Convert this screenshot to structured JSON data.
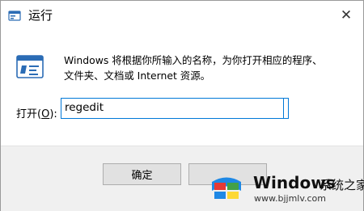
{
  "window": {
    "title": "运行",
    "close_glyph": "✕"
  },
  "content": {
    "description_line1": "Windows 将根据你所输入的名称，为你打开相应的程序、",
    "description_line2": "文件夹、文档或 Internet 资源。",
    "open_label_prefix": "打开(",
    "open_label_key": "O",
    "open_label_suffix": "):",
    "input_value": "regedit"
  },
  "buttons": {
    "ok_label": "确定",
    "cancel_label": ""
  },
  "watermark": {
    "title": "Windows",
    "subtitle": "系统之家",
    "url": "www.bjjmlv.com"
  },
  "icons": {
    "app_icon": "run-icon",
    "close_icon": "close-icon",
    "large_icon": "run-large-icon",
    "watermark_logo": "windows-logo-icon"
  },
  "colors": {
    "accent": "#0078d7",
    "footer_bg": "#f0f0f0",
    "button_bg": "#e1e1e1"
  }
}
